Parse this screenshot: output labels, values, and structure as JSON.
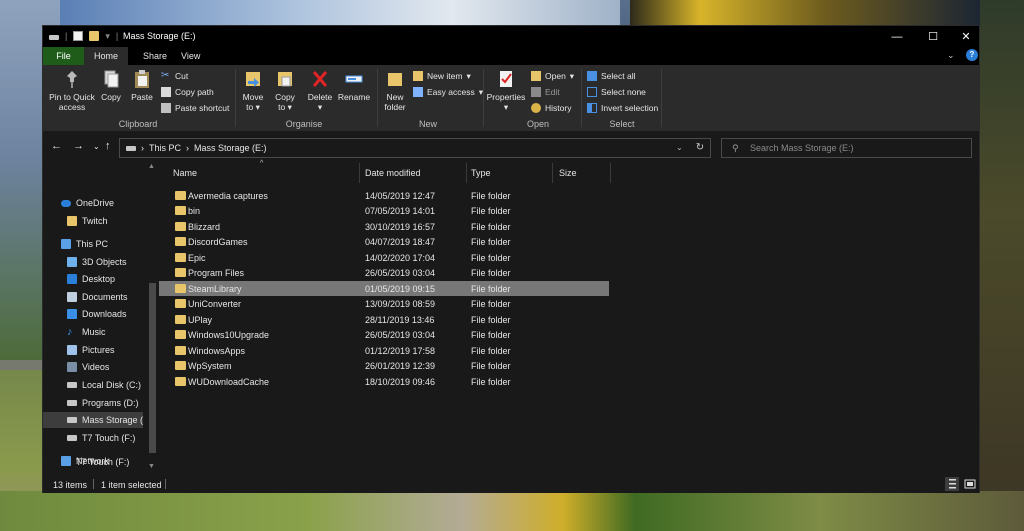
{
  "window": {
    "title": "Mass Storage (E:)"
  },
  "colors": {
    "accent_file_tab": "#1f5c1a",
    "folder": "#e8c56a",
    "selection": "#777777",
    "help": "#2a7fd9"
  },
  "tabs": [
    {
      "label": "File"
    },
    {
      "label": "Home",
      "active": true
    },
    {
      "label": "Share"
    },
    {
      "label": "View"
    }
  ],
  "ribbon": {
    "clipboard": {
      "pin_label_1": "Pin to Quick",
      "pin_label_2": "access",
      "copy": "Copy",
      "paste": "Paste",
      "cut": "Cut",
      "copy_path": "Copy path",
      "paste_shortcut": "Paste shortcut",
      "group": "Clipboard"
    },
    "organise": {
      "move_to_1": "Move",
      "move_to_2": "to",
      "copy_to_1": "Copy",
      "copy_to_2": "to",
      "delete": "Delete",
      "rename": "Rename",
      "group": "Organise"
    },
    "new": {
      "new_folder_1": "New",
      "new_folder_2": "folder",
      "new_item": "New item",
      "easy_access": "Easy access",
      "group": "New"
    },
    "open": {
      "properties": "Properties",
      "open": "Open",
      "edit": "Edit",
      "history": "History",
      "group": "Open"
    },
    "select": {
      "select_all": "Select all",
      "select_none": "Select none",
      "invert_selection": "Invert selection",
      "group": "Select"
    }
  },
  "address": {
    "crumb1": "This PC",
    "crumb2": "Mass Storage (E:)",
    "search_placeholder": "Search Mass Storage (E:)"
  },
  "nav": [
    {
      "label": "OneDrive",
      "icon": "cloud-icon"
    },
    {
      "label": "Twitch",
      "icon": "folder-icon"
    },
    {
      "label": "This PC",
      "icon": "computer-icon"
    },
    {
      "label": "3D Objects",
      "icon": "cube-icon"
    },
    {
      "label": "Desktop",
      "icon": "desktop-icon"
    },
    {
      "label": "Documents",
      "icon": "document-icon"
    },
    {
      "label": "Downloads",
      "icon": "download-icon"
    },
    {
      "label": "Music",
      "icon": "music-icon"
    },
    {
      "label": "Pictures",
      "icon": "pictures-icon"
    },
    {
      "label": "Videos",
      "icon": "video-icon"
    },
    {
      "label": "Local Disk (C:)",
      "icon": "disk-icon"
    },
    {
      "label": "Programs (D:)",
      "icon": "drive-icon"
    },
    {
      "label": "Mass Storage (E:)",
      "icon": "drive-icon",
      "selected": true
    },
    {
      "label": "T7 Touch (F:)",
      "icon": "drive-icon"
    },
    {
      "label": "T7 Touch (F:)",
      "icon": "drive-icon"
    },
    {
      "label": "Network",
      "icon": "network-icon"
    }
  ],
  "columns": {
    "name": "Name",
    "date": "Date modified",
    "type": "Type",
    "size": "Size"
  },
  "files": [
    {
      "name": "Avermedia captures",
      "date": "14/05/2019 12:47",
      "type": "File folder"
    },
    {
      "name": "bin",
      "date": "07/05/2019 14:01",
      "type": "File folder"
    },
    {
      "name": "Blizzard",
      "date": "30/10/2019 16:57",
      "type": "File folder"
    },
    {
      "name": "DiscordGames",
      "date": "04/07/2019 18:47",
      "type": "File folder"
    },
    {
      "name": "Epic",
      "date": "14/02/2020 17:04",
      "type": "File folder"
    },
    {
      "name": "Program Files",
      "date": "26/05/2019 03:04",
      "type": "File folder"
    },
    {
      "name": "SteamLibrary",
      "date": "01/05/2019 09:15",
      "type": "File folder",
      "selected": true
    },
    {
      "name": "UniConverter",
      "date": "13/09/2019 08:59",
      "type": "File folder"
    },
    {
      "name": "UPlay",
      "date": "28/11/2019 13:46",
      "type": "File folder"
    },
    {
      "name": "Windows10Upgrade",
      "date": "26/05/2019 03:04",
      "type": "File folder"
    },
    {
      "name": "WindowsApps",
      "date": "01/12/2019 17:58",
      "type": "File folder"
    },
    {
      "name": "WpSystem",
      "date": "26/01/2019 12:39",
      "type": "File folder"
    },
    {
      "name": "WUDownloadCache",
      "date": "18/10/2019 09:46",
      "type": "File folder"
    }
  ],
  "status": {
    "items": "13 items",
    "selected": "1 item selected"
  }
}
